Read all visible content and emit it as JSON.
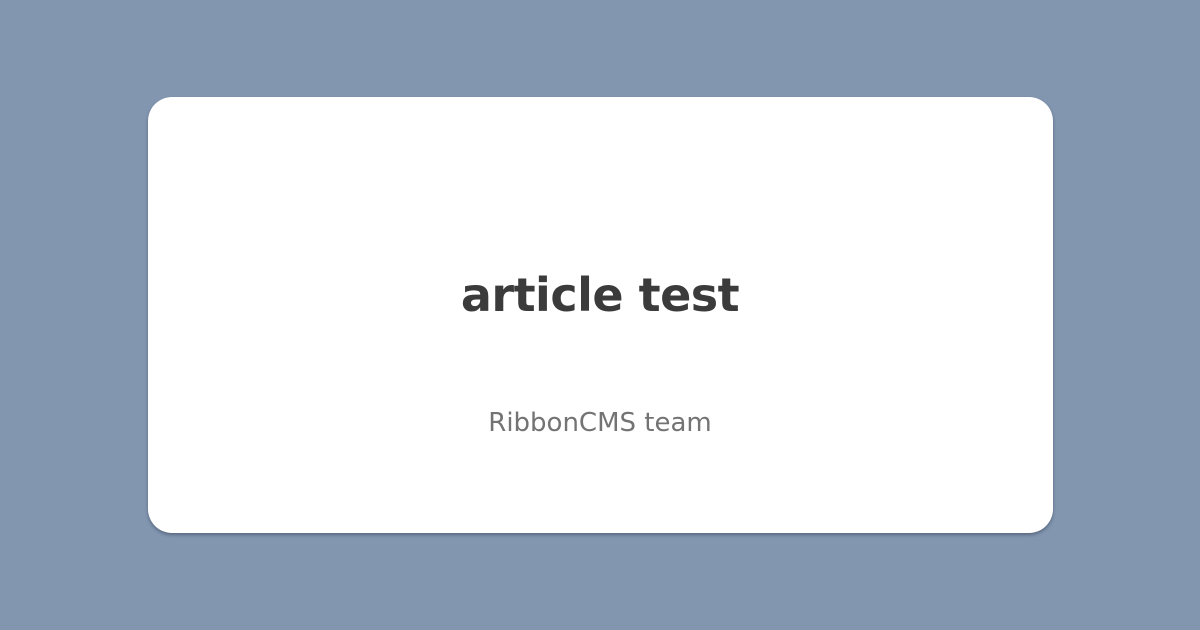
{
  "card": {
    "title": "article test",
    "author": "RibbonCMS team"
  },
  "colors": {
    "background": "#8296b0",
    "card": "#ffffff",
    "title": "#3b3b3b",
    "author": "#737373"
  }
}
